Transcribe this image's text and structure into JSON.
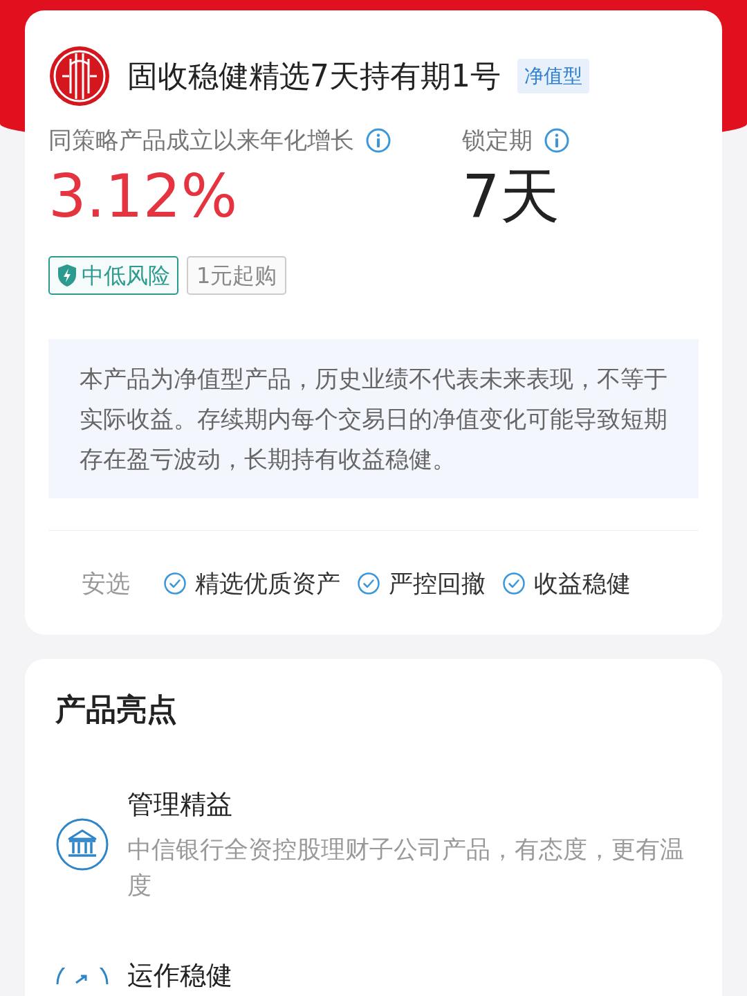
{
  "product": {
    "title": "固收稳健精选7天持有期1号",
    "type_badge": "净值型"
  },
  "metrics": [
    {
      "label": "同策略产品成立以来年化增长",
      "value": "3.12%",
      "kind": "rate"
    },
    {
      "label": "锁定期",
      "value": "7天",
      "kind": "term"
    }
  ],
  "tags": [
    {
      "label": "中低风险",
      "kind": "risk"
    },
    {
      "label": "1元起购",
      "kind": "plain"
    }
  ],
  "notice": "本产品为净值型产品，历史业绩不代表未来表现，不等于实际收益。存续期内每个交易日的净值变化可能导致短期存在盈亏波动，长期持有收益稳健。",
  "features": {
    "label": "安选",
    "items": [
      "精选优质资产",
      "严控回撤",
      "收益稳健"
    ]
  },
  "highlights": {
    "title": "产品亮点",
    "items": [
      {
        "kind": "bank",
        "title": "管理精益",
        "description": "中信银行全资控股理财子公司产品，有态度，更有温度"
      },
      {
        "kind": "growth",
        "title": "运作稳健"
      }
    ]
  }
}
